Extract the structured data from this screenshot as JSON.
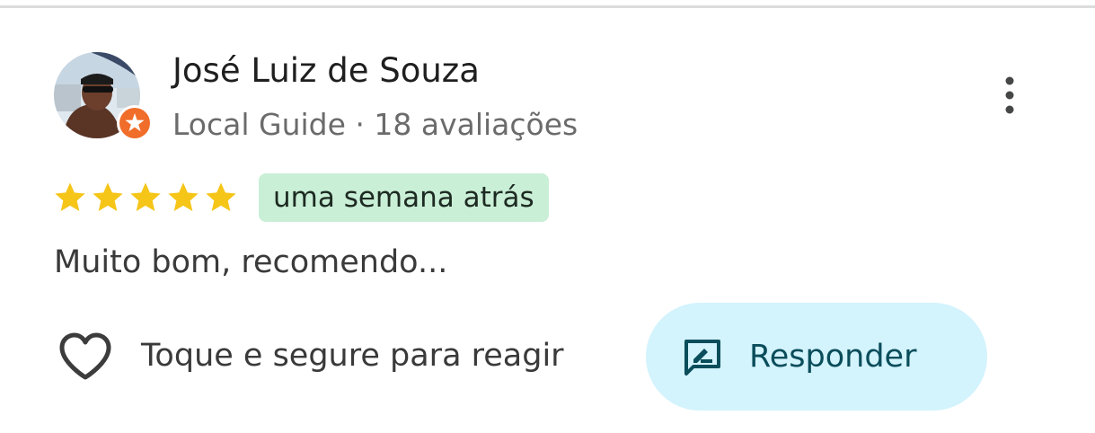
{
  "reviewer": {
    "name": "José Luiz de Souza",
    "meta": "Local Guide · 18 avaliações"
  },
  "review": {
    "rating": 5,
    "rating_max": 5,
    "time_ago": "uma semana atrás",
    "text": "Muito bom, recomendo..."
  },
  "actions": {
    "react_label": "Toque e segure para reagir",
    "reply_label": "Responder"
  },
  "icons": {
    "avatar": "user-photo",
    "badge": "local-guide-star-icon",
    "more": "more-vertical-icon",
    "star": "star-icon",
    "heart": "heart-outline-icon",
    "reply": "reply-chat-icon"
  },
  "colors": {
    "star": "#f5c518",
    "badge": "#f06d2a",
    "time_chip_bg": "#c9efd6",
    "reply_bg": "#d3f3fd",
    "reply_text": "#0a4d5b"
  }
}
